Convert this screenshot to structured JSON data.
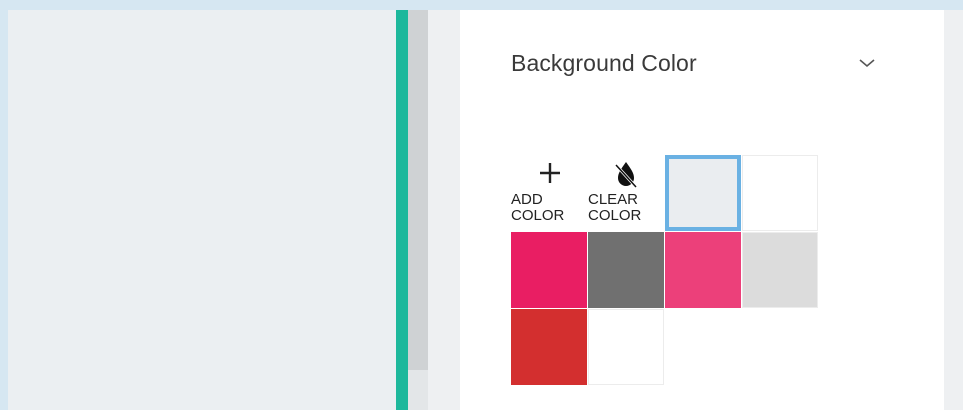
{
  "background_section": {
    "title": "Background Color",
    "expand_icon": "chevron-down-icon"
  },
  "tools": {
    "add_color_label": "ADD COLOR",
    "add_color_icon": "plus-icon",
    "clear_color_label": "CLEAR COLOR",
    "clear_color_icon": "no-drop-icon"
  },
  "swatches": [
    {
      "color": "#eaedf0",
      "selected": true
    },
    {
      "color": "#ffffff",
      "selected": false
    },
    {
      "color": "#e91e63",
      "selected": false
    },
    {
      "color": "#707070",
      "selected": false
    },
    {
      "color": "#ec407a",
      "selected": false
    },
    {
      "color": "#dcdcdc",
      "selected": false
    },
    {
      "color": "#d32f2f",
      "selected": false
    },
    {
      "color": "#ffffff",
      "selected": false
    }
  ],
  "colors": {
    "accent": "#1db89c",
    "selection_outline": "#6ab1e3"
  }
}
